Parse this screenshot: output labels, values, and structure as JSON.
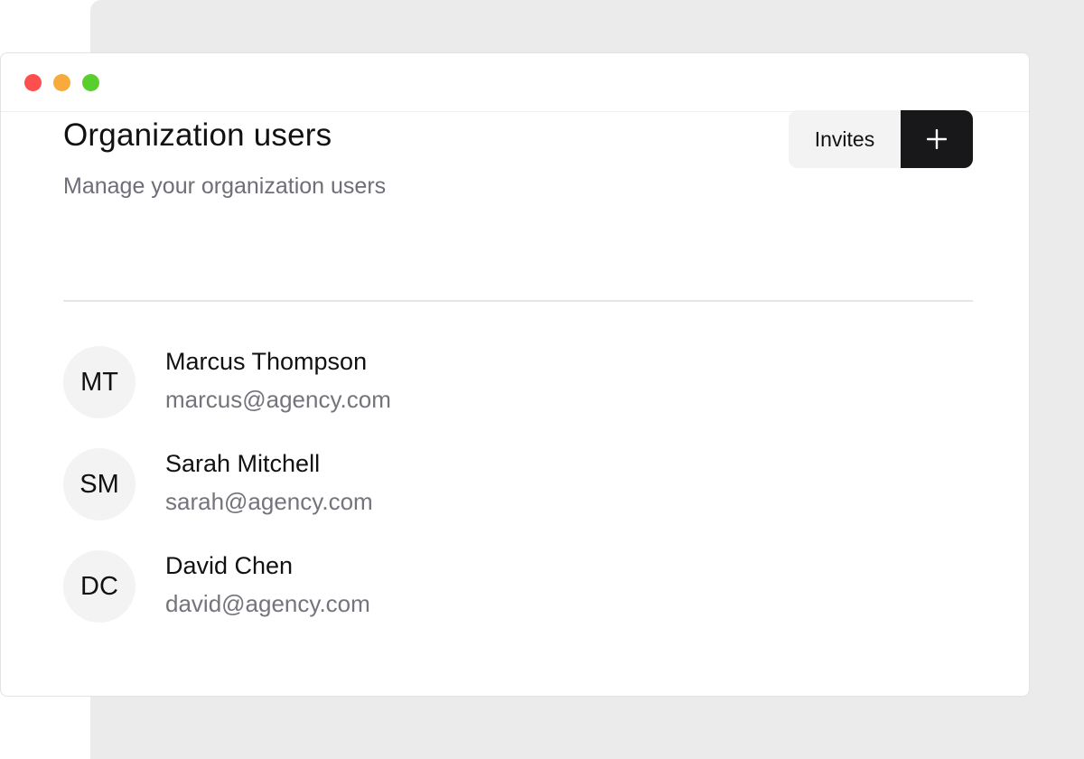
{
  "window": {
    "controls": [
      "close",
      "minimize",
      "maximize"
    ],
    "colors": {
      "close": "#fe4f4f",
      "minimize": "#f7ab3c",
      "maximize": "#5ace2f"
    }
  },
  "header": {
    "title": "Organization users",
    "subtitle": "Manage your organization users",
    "invites_label": "Invites",
    "add_icon": "plus-icon"
  },
  "users": [
    {
      "initials": "MT",
      "name": "Marcus Thompson",
      "email": "marcus@agency.com"
    },
    {
      "initials": "SM",
      "name": "Sarah Mitchell",
      "email": "sarah@agency.com"
    },
    {
      "initials": "DC",
      "name": "David Chen",
      "email": "david@agency.com"
    }
  ],
  "colors": {
    "accent_dark": "#18181b",
    "muted_text": "#6e6e78",
    "avatar_bg": "#f3f3f3"
  }
}
